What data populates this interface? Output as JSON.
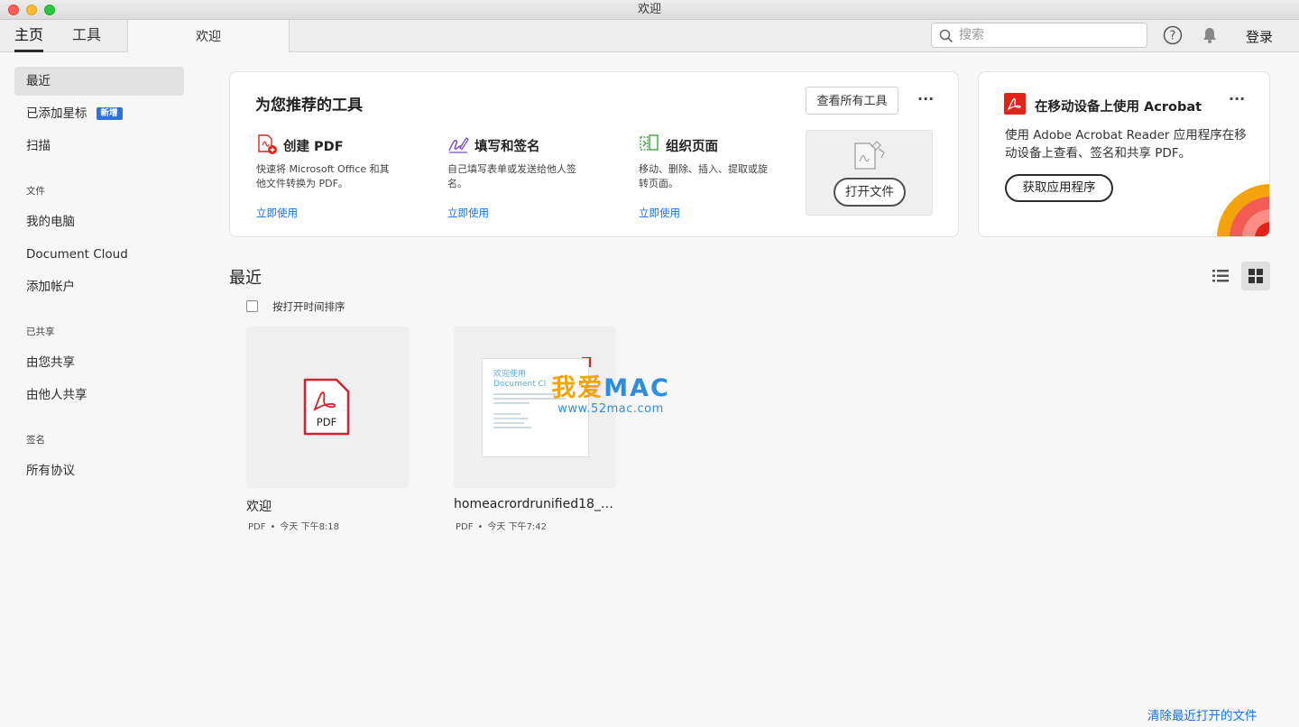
{
  "window": {
    "title": "欢迎"
  },
  "topnav": {
    "home_label": "主页",
    "tools_label": "工具",
    "doc_tab_label": "欢迎",
    "search_placeholder": "搜索",
    "login_label": "登录"
  },
  "sidebar": {
    "recent": "最近",
    "starred": "已添加星标",
    "starred_badge": "新增",
    "scan": "扫描",
    "files_heading": "文件",
    "my_computer": "我的电脑",
    "document_cloud": "Document Cloud",
    "add_account": "添加帐户",
    "shared_heading": "已共享",
    "shared_by_you": "由您共享",
    "shared_by_others": "由他人共享",
    "sign_heading": "签名",
    "all_agreements": "所有协议"
  },
  "tools_card": {
    "title": "为您推荐的工具",
    "see_all": "查看所有工具",
    "more": "···",
    "tools": [
      {
        "name": "创建 PDF",
        "desc": "快速将 Microsoft Office 和其他文件转换为 PDF。",
        "link": "立即使用",
        "icon": "create-pdf-icon",
        "color": "#e2231a"
      },
      {
        "name": "填写和签名",
        "desc": "自己填写表单或发送给他人签名。",
        "link": "立即使用",
        "icon": "fill-sign-icon",
        "color": "#7b4fc7"
      },
      {
        "name": "组织页面",
        "desc": "移动、删除、插入、提取或旋转页面。",
        "link": "立即使用",
        "icon": "organize-pages-icon",
        "color": "#3aa83a"
      }
    ],
    "open_file": "打开文件"
  },
  "mobile_card": {
    "title": "在移动设备上使用 Acrobat",
    "more": "···",
    "desc": "使用 Adobe Acrobat Reader 应用程序在移动设备上查看、签名和共享 PDF。",
    "get_app": "获取应用程序"
  },
  "recent": {
    "title": "最近",
    "sort_label": "按打开时间排序",
    "files": [
      {
        "name": "欢迎",
        "type": "PDF",
        "sep": "•",
        "time": "今天 下午8:18",
        "thumb_label": "PDF"
      },
      {
        "name": "homeacrordrunified18_20...",
        "type": "PDF",
        "sep": "•",
        "time": "今天 下午7:42",
        "preview_title": "欢迎使用",
        "preview_subtitle": "Document Cl"
      }
    ],
    "clear_label": "清除最近打开的文件"
  },
  "watermark": {
    "big_a": "我爱",
    "big_b": "MAC",
    "small": "www.52mac.com"
  },
  "colors": {
    "accent_link": "#1473e6",
    "adobe_red": "#e2231a",
    "badge_blue": "#2d74da"
  }
}
